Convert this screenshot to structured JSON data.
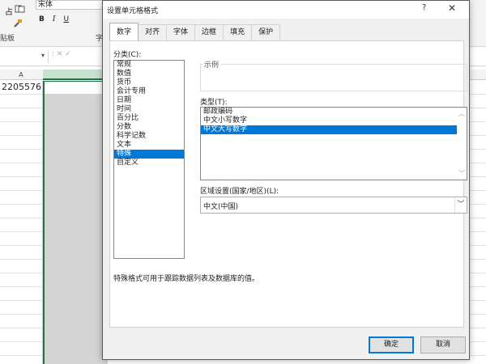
{
  "excel": {
    "font_box": "宋体",
    "ribbon_labels": {
      "clipboard": "贴板",
      "font": "字"
    },
    "format_buttons": {
      "bold": "B",
      "italic": "I",
      "underline": "U"
    },
    "paste_label": "占",
    "namebox_arrow": "▾",
    "fx_symbols": ":  ✕  ✓",
    "column_a": "A",
    "cell_value": "2205576"
  },
  "dialog": {
    "title": "设置单元格格式",
    "help": "?",
    "close": "✕",
    "tabs": [
      "数字",
      "对齐",
      "字体",
      "边框",
      "填充",
      "保护"
    ],
    "active_tab": 0,
    "category_label": "分类(C):",
    "categories": [
      "常规",
      "数值",
      "货币",
      "会计专用",
      "日期",
      "时间",
      "百分比",
      "分数",
      "科学记数",
      "文本",
      "特殊",
      "自定义"
    ],
    "selected_category": 10,
    "sample_label": "示例",
    "type_label": "类型(T):",
    "types": [
      "邮政编码",
      "中文小写数字",
      "中文大写数字"
    ],
    "selected_type": 2,
    "locale_label": "区域设置(国家/地区)(L):",
    "locale_value": "中文(中国)",
    "description": "特殊格式可用于跟踪数据列表及数据库的值。",
    "ok": "确定",
    "cancel": "取消"
  },
  "colors": {
    "accent": "#0078d7",
    "excel_green": "#217346"
  }
}
